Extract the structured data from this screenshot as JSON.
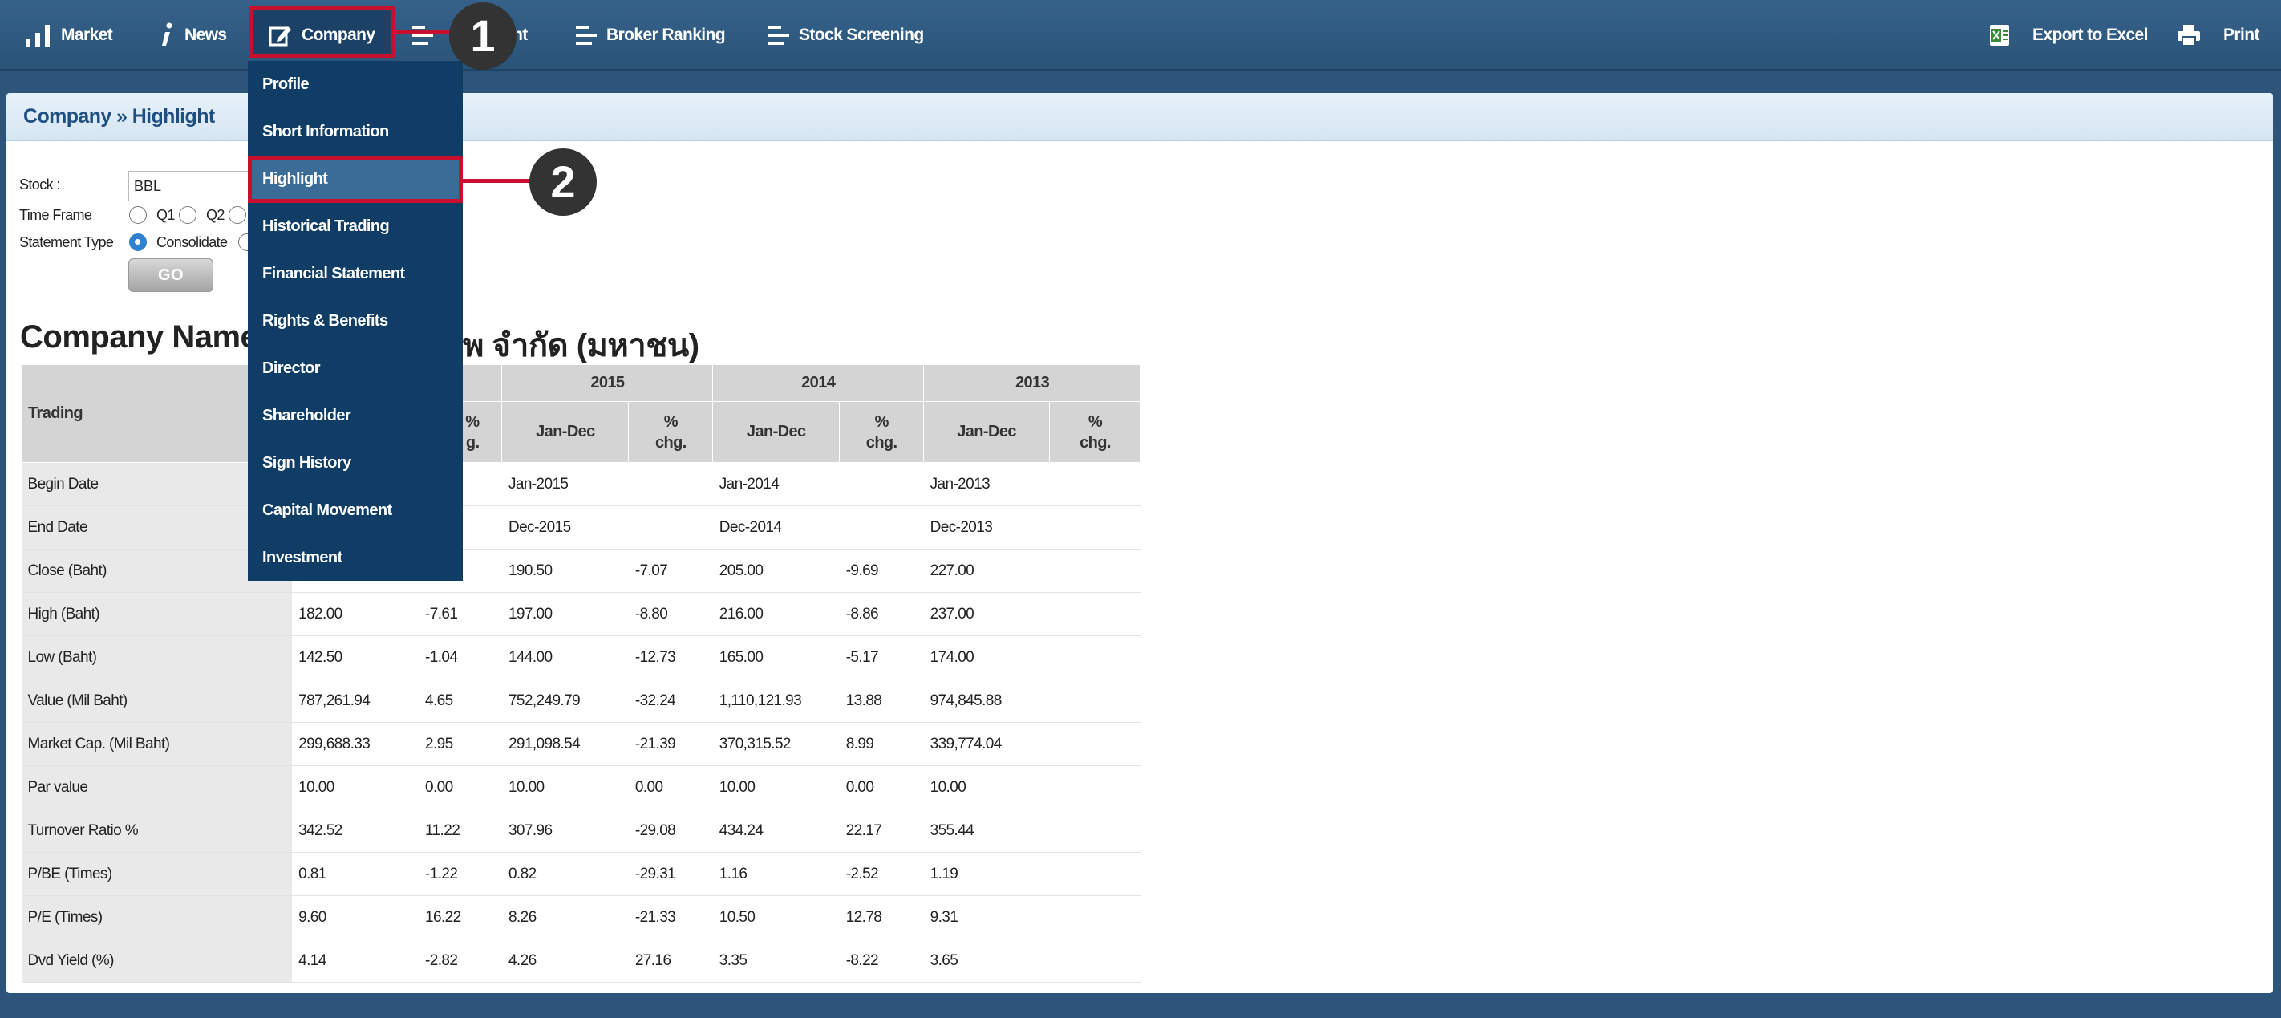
{
  "nav": {
    "items": [
      {
        "label": "Market",
        "icon": "bar-chart-icon"
      },
      {
        "label": "News",
        "icon": "info-icon"
      },
      {
        "label": "Company",
        "icon": "edit-icon"
      },
      {
        "label": "ent",
        "icon": "list-icon"
      },
      {
        "label": "Broker Ranking",
        "icon": "list-icon"
      },
      {
        "label": "Stock Screening",
        "icon": "list-icon"
      }
    ],
    "right": [
      {
        "label": "Export to Excel",
        "icon": "excel-icon"
      },
      {
        "label": "Print",
        "icon": "print-icon"
      }
    ]
  },
  "breadcrumb": "Company » Highlight",
  "form": {
    "stock_label": "Stock :",
    "stock_value": "BBL",
    "timeframe_label": "Time Frame",
    "q1_label": "Q1",
    "q2_label": "Q2",
    "statement_label": "Statement Type",
    "consolidate_label": "Consolidate",
    "go_label": "GO"
  },
  "company_title_left": "Company Name",
  "company_title_right": "พ จำกัด (มหาชน)",
  "table": {
    "header_trading": "Trading",
    "years": [
      "2015",
      "2014",
      "2013"
    ],
    "partial_pct": "%",
    "partial_chg": "g.",
    "period_label": "Jan-Dec",
    "pct_label": "%",
    "chg_label": "chg.",
    "rows": [
      {
        "label": "Begin Date",
        "cells": [
          "",
          "",
          "Jan-2015",
          "",
          "Jan-2014",
          "",
          "Jan-2013",
          ""
        ]
      },
      {
        "label": "End Date",
        "cells": [
          "",
          "",
          "Dec-2015",
          "",
          "Dec-2014",
          "",
          "Dec-2013",
          ""
        ]
      },
      {
        "label": "Close (Baht)",
        "cells": [
          "",
          "",
          "190.50",
          "-7.07",
          "205.00",
          "-9.69",
          "227.00",
          ""
        ]
      },
      {
        "label": "High (Baht)",
        "cells": [
          "182.00",
          "-7.61",
          "197.00",
          "-8.80",
          "216.00",
          "-8.86",
          "237.00",
          ""
        ]
      },
      {
        "label": "Low (Baht)",
        "cells": [
          "142.50",
          "-1.04",
          "144.00",
          "-12.73",
          "165.00",
          "-5.17",
          "174.00",
          ""
        ]
      },
      {
        "label": "Value (Mil Baht)",
        "cells": [
          "787,261.94",
          "4.65",
          "752,249.79",
          "-32.24",
          "1,110,121.93",
          "13.88",
          "974,845.88",
          ""
        ]
      },
      {
        "label": "Market Cap. (Mil Baht)",
        "cells": [
          "299,688.33",
          "2.95",
          "291,098.54",
          "-21.39",
          "370,315.52",
          "8.99",
          "339,774.04",
          ""
        ]
      },
      {
        "label": "Par value",
        "cells": [
          "10.00",
          "0.00",
          "10.00",
          "0.00",
          "10.00",
          "0.00",
          "10.00",
          ""
        ]
      },
      {
        "label": "Turnover Ratio %",
        "cells": [
          "342.52",
          "11.22",
          "307.96",
          "-29.08",
          "434.24",
          "22.17",
          "355.44",
          ""
        ]
      },
      {
        "label": "P/BE (Times)",
        "cells": [
          "0.81",
          "-1.22",
          "0.82",
          "-29.31",
          "1.16",
          "-2.52",
          "1.19",
          ""
        ]
      },
      {
        "label": "P/E (Times)",
        "cells": [
          "9.60",
          "16.22",
          "8.26",
          "-21.33",
          "10.50",
          "12.78",
          "9.31",
          ""
        ]
      },
      {
        "label": "Dvd Yield (%)",
        "cells": [
          "4.14",
          "-2.82",
          "4.26",
          "27.16",
          "3.35",
          "-8.22",
          "3.65",
          ""
        ]
      }
    ]
  },
  "dropdown": {
    "items": [
      "Profile",
      "Short Information",
      "Highlight",
      "Historical Trading",
      "Financial Statement",
      "Rights & Benefits",
      "Director",
      "Shareholder",
      "Sign History",
      "Capital Movement",
      "Investment"
    ],
    "active": "Highlight"
  },
  "callouts": [
    "1",
    "2"
  ],
  "colors": {
    "nav_bg": "#2d5579",
    "dropdown_bg": "#0f3d66",
    "highlight_border": "#c8102e",
    "breadcrumb_text": "#1f4f80"
  }
}
